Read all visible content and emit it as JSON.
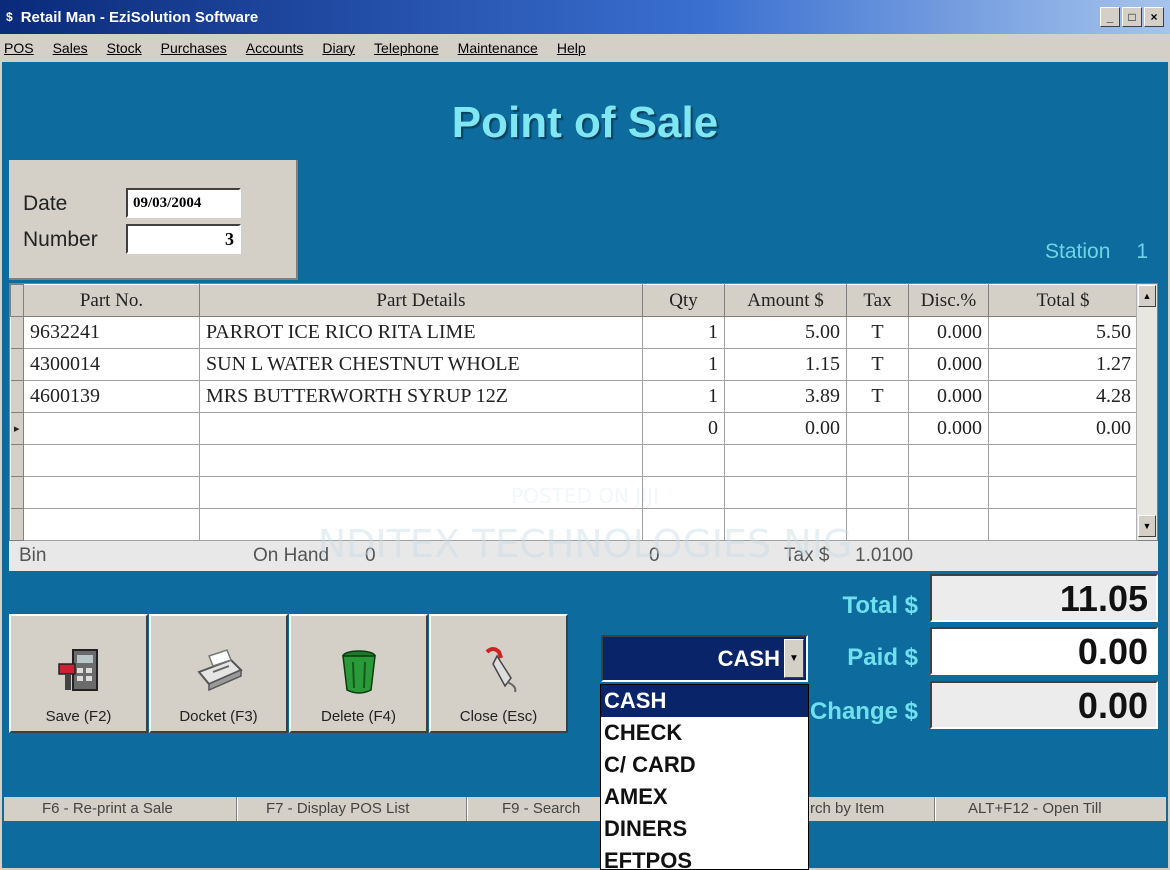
{
  "window": {
    "title": "Retail Man - EziSolution Software",
    "minimize": "_",
    "maximize": "□",
    "close": "×"
  },
  "menu": [
    "POS",
    "Sales",
    "Stock",
    "Purchases",
    "Accounts",
    "Diary",
    "Telephone",
    "Maintenance",
    "Help"
  ],
  "header": {
    "title": "Point of Sale",
    "station_label": "Station",
    "station_value": "1"
  },
  "sale": {
    "date_label": "Date",
    "date_value": "09/03/2004",
    "number_label": "Number",
    "number_value": "3"
  },
  "grid": {
    "columns": [
      "Part No.",
      "Part Details",
      "Qty",
      "Amount $",
      "Tax",
      "Disc.%",
      "Total $"
    ],
    "rows": [
      [
        "9632241",
        "PARROT ICE RICO RITA LIME",
        "1",
        "5.00",
        "T",
        "0.000",
        "5.50"
      ],
      [
        "4300014",
        "SUN L WATER CHESTNUT WHOLE",
        "1",
        "1.15",
        "T",
        "0.000",
        "1.27"
      ],
      [
        "4600139",
        "MRS BUTTERWORTH SYRUP 12Z",
        "1",
        "3.89",
        "T",
        "0.000",
        "4.28"
      ],
      [
        "",
        "",
        "0",
        "0.00",
        "",
        "0.000",
        "0.00"
      ],
      [
        "",
        "",
        "",
        "",
        "",
        "",
        ""
      ],
      [
        "",
        "",
        "",
        "",
        "",
        "",
        ""
      ],
      [
        "",
        "",
        "",
        "",
        "",
        "",
        ""
      ]
    ]
  },
  "info": {
    "bin_label": "Bin",
    "on_hand_label": "On Hand",
    "on_hand_value": "0",
    "qty_value": "0",
    "tax_label": "Tax $",
    "tax_value": "1.0100"
  },
  "totals": {
    "total_label": "Total $",
    "total_value": "11.05",
    "paid_label": "Paid $",
    "paid_value": "0.00",
    "change_label": "Change $",
    "change_value": "0.00"
  },
  "buttons": {
    "save": "Save (F2)",
    "docket": "Docket (F3)",
    "delete": "Delete (F4)",
    "close": "Close (Esc)"
  },
  "payment": {
    "selected": "CASH",
    "options": [
      "CASH",
      "CHECK",
      "C/ CARD",
      "AMEX",
      "DINERS",
      "EFTPOS"
    ]
  },
  "statusbar": {
    "f6": "F6 - Re-print a Sale",
    "f7": "F7 - Display POS List",
    "f9": "F9 - Search",
    "search_item": "rch by Item",
    "alt_f12": "ALT+F12 - Open Till"
  },
  "watermark": {
    "line1": "POSTED ON JIJI",
    "line2": "NDITEX TECHNOLOGIES NIG"
  },
  "colors": {
    "background": "#0e6b9e",
    "title_text": "#7fe6f2",
    "selection": "#0a246a",
    "panel": "#d4d0c8"
  }
}
